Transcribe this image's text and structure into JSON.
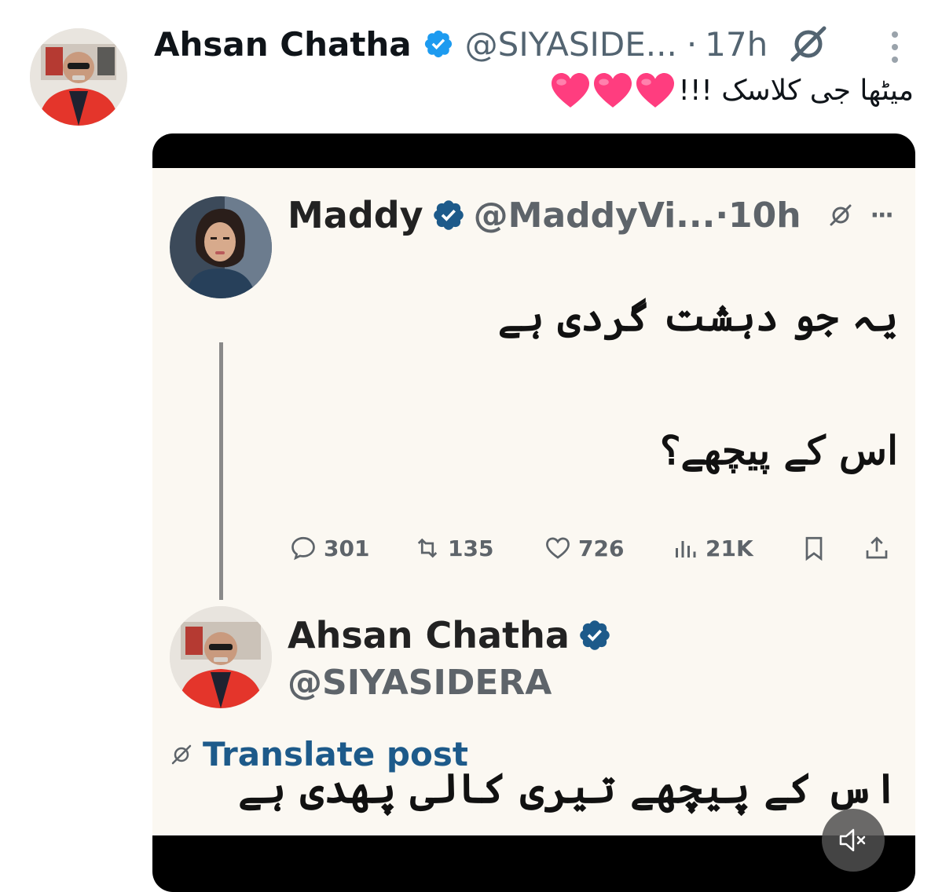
{
  "post": {
    "author_name": "Ahsan Chatha",
    "handle": "@SIYASIDE...",
    "separator": "·",
    "time": "17h",
    "avatar_icon": "profile-photo",
    "text": "میٹھا جی کلاسک !!!",
    "emoji": "heart-emoji x3"
  },
  "media": {
    "quoted_post": {
      "author_name": "Maddy",
      "handle": "@MaddyVi...",
      "time": "·10h",
      "more": "···",
      "line1": "یہ جو دہشت گردی ہے",
      "line2": "اس کے پیچھے؟"
    },
    "actions": {
      "replies": "301",
      "reposts": "135",
      "likes": "726",
      "views": "21K"
    },
    "reply": {
      "author_name": "Ahsan Chatha",
      "handle": "@SIYASIDERA",
      "translate_label": "Translate post",
      "text": "اس کے پیچھے تیری کالی پھدی ہے"
    }
  },
  "colors": {
    "verified_blue": "#1d9bf0",
    "muted_gray": "#536471",
    "translate_blue": "#1d5a8a",
    "card_bg": "#fbf8f2",
    "heart_pink": "#ff3d7f"
  }
}
